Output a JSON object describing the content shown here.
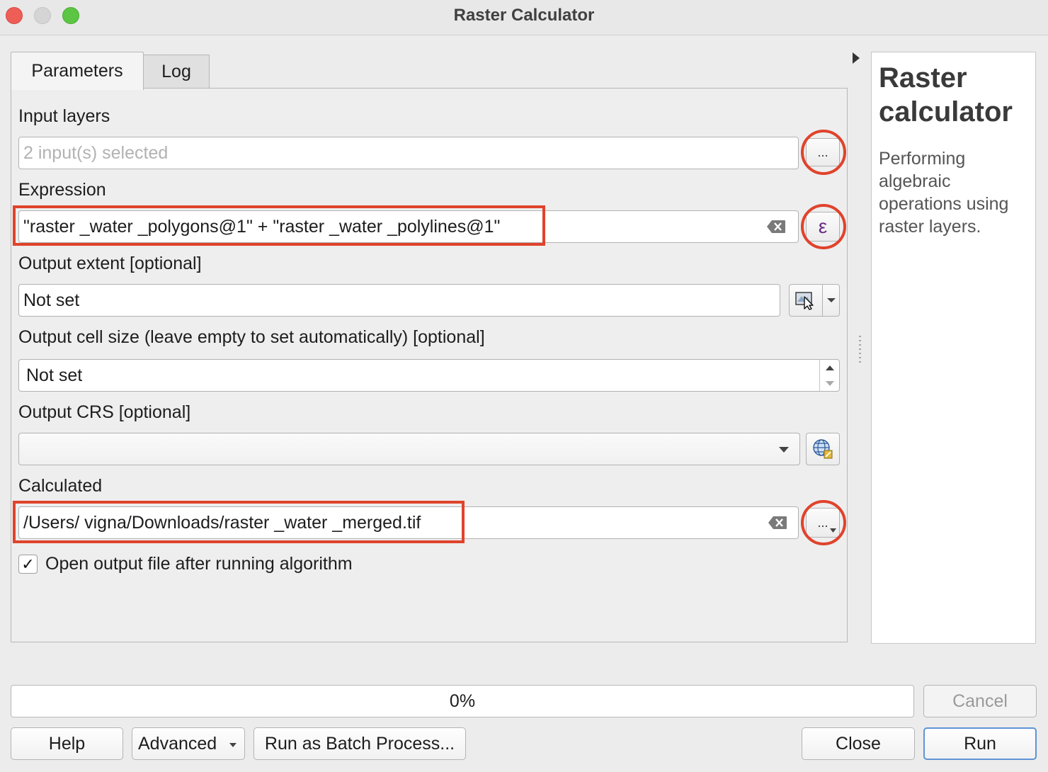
{
  "window": {
    "title": "Raster Calculator"
  },
  "tabs": [
    {
      "label": "Parameters"
    },
    {
      "label": "Log"
    }
  ],
  "params": {
    "input_layers": {
      "label": "Input layers",
      "placeholder": "2 input(s) selected",
      "browse_label": "..."
    },
    "expression": {
      "label": "Expression",
      "value": "\"raster _water _polygons@1\" + \"raster _water _polylines@1\"",
      "builder_symbol": "ε"
    },
    "output_extent": {
      "label": "Output extent [optional]",
      "value": "Not set"
    },
    "output_cell_size": {
      "label": "Output cell size (leave empty to set automatically) [optional]",
      "value": "Not set"
    },
    "output_crs": {
      "label": "Output CRS [optional]",
      "value": ""
    },
    "calculated": {
      "label": "Calculated",
      "value": "/Users/ vigna/Downloads/raster _water _merged.tif",
      "browse_label": "..."
    },
    "open_output": {
      "label": "Open output file after running algorithm",
      "checked": true,
      "check_glyph": "✓"
    }
  },
  "help": {
    "title": "Raster calculator",
    "description": "Performing algebraic operations using raster layers."
  },
  "progress": {
    "value": 0,
    "text": "0%"
  },
  "buttons": {
    "cancel": "Cancel",
    "help": "Help",
    "advanced": "Advanced",
    "batch": "Run as Batch Process...",
    "close": "Close",
    "run": "Run"
  },
  "colors": {
    "annotation": "#e0432c",
    "default_button": "#5f94d6"
  }
}
